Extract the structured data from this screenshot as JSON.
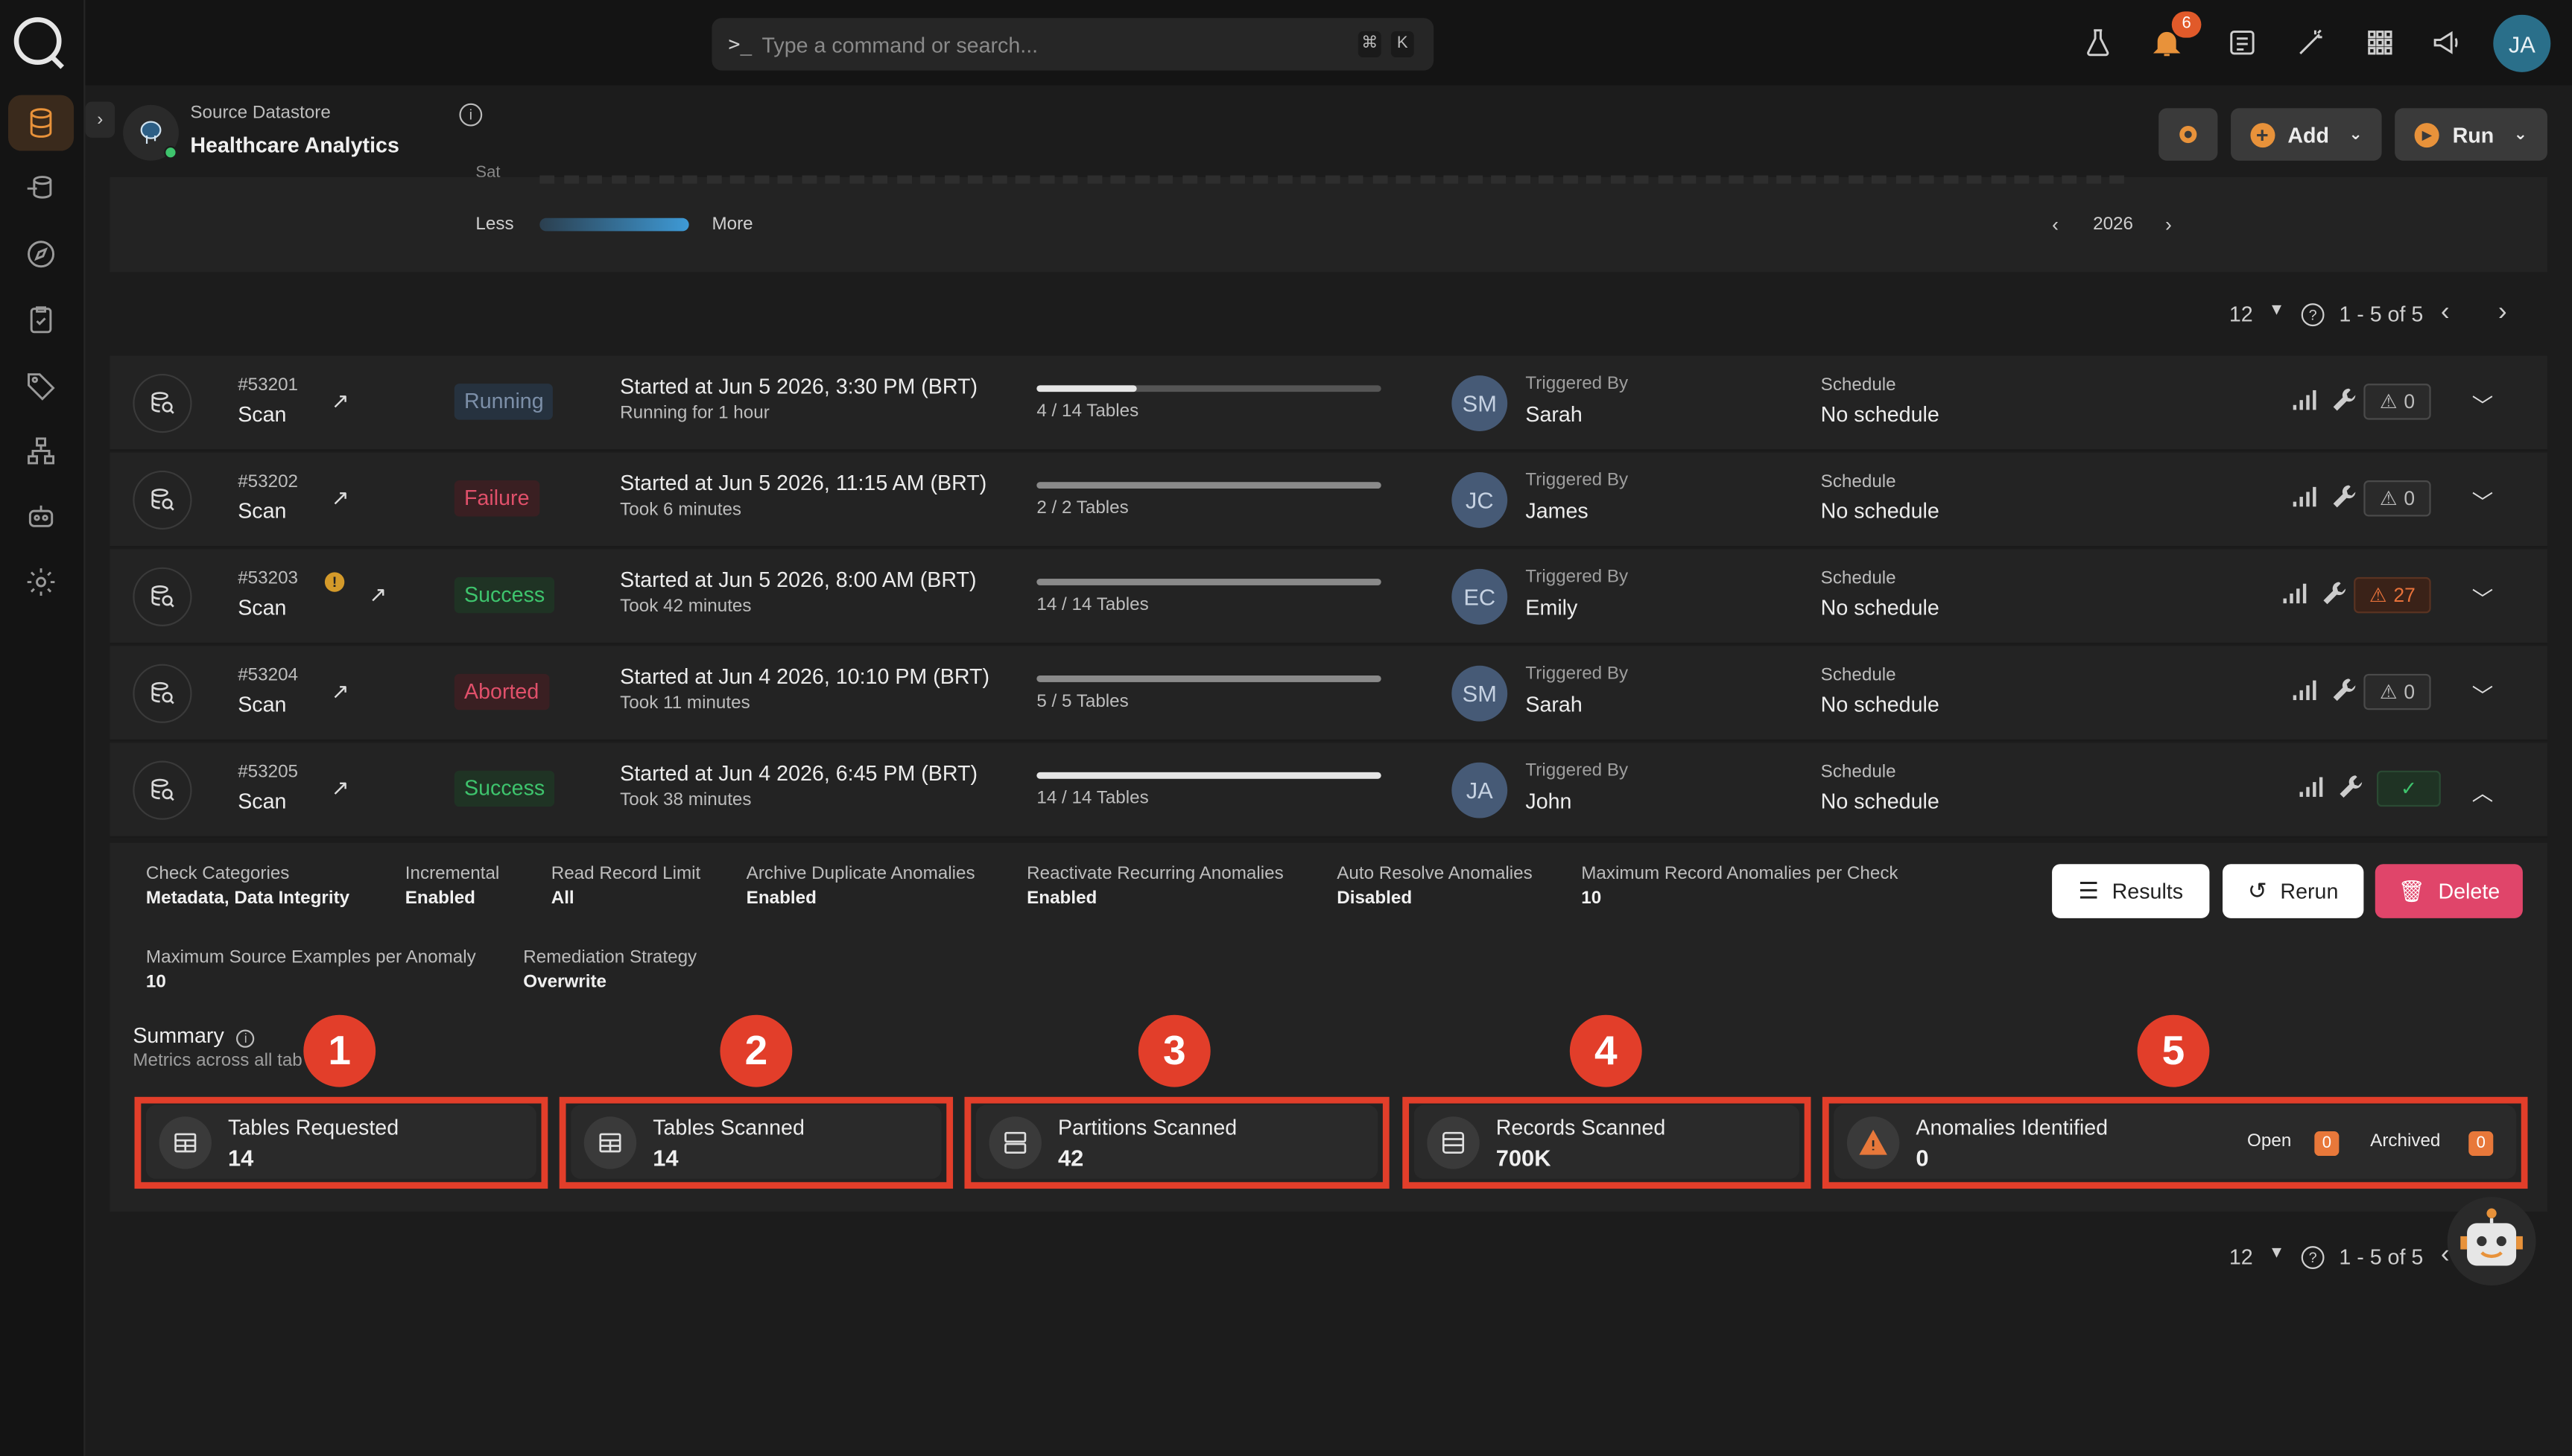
{
  "search": {
    "placeholder": "Type a command or search...",
    "shortcut_mod": "⌘",
    "shortcut_key": "K"
  },
  "notifications": {
    "count": "6"
  },
  "user": {
    "initials": "JA"
  },
  "datastore": {
    "label": "Source Datastore",
    "name": "Healthcare Analytics"
  },
  "header_buttons": {
    "add": "Add",
    "run": "Run"
  },
  "heatmap": {
    "less": "Less",
    "more": "More",
    "year": "2026",
    "clipped_label": "Sat"
  },
  "pager": {
    "per_page": "12",
    "range": "1 - 5 of 5"
  },
  "scans": [
    {
      "id": "#53201",
      "type": "Scan",
      "status": "Running",
      "started": "Started at Jun 5 2026, 3:30 PM (BRT)",
      "duration": "Running for 1 hour",
      "progress": 0.29,
      "tables": "4 / 14 Tables",
      "initials": "SM",
      "triggered_label": "Triggered By",
      "triggered_by": "Sarah",
      "schedule_label": "Schedule",
      "schedule": "No schedule",
      "anomalies": "0"
    },
    {
      "id": "#53202",
      "type": "Scan",
      "status": "Failure",
      "started": "Started at Jun 5 2026, 11:15 AM (BRT)",
      "duration": "Took 6 minutes",
      "progress": 1.0,
      "tables": "2 / 2 Tables",
      "initials": "JC",
      "triggered_label": "Triggered By",
      "triggered_by": "James",
      "schedule_label": "Schedule",
      "schedule": "No schedule",
      "anomalies": "0"
    },
    {
      "id": "#53203",
      "type": "Scan",
      "status": "Success",
      "started": "Started at Jun 5 2026, 8:00 AM (BRT)",
      "duration": "Took 42 minutes",
      "progress": 1.0,
      "tables": "14 / 14 Tables",
      "initials": "EC",
      "triggered_label": "Triggered By",
      "triggered_by": "Emily",
      "schedule_label": "Schedule",
      "schedule": "No schedule",
      "anomalies": "27"
    },
    {
      "id": "#53204",
      "type": "Scan",
      "status": "Aborted",
      "started": "Started at Jun 4 2026, 10:10 PM (BRT)",
      "duration": "Took 11 minutes",
      "progress": 1.0,
      "tables": "5 / 5 Tables",
      "initials": "SM",
      "triggered_label": "Triggered By",
      "triggered_by": "Sarah",
      "schedule_label": "Schedule",
      "schedule": "No schedule",
      "anomalies": "0"
    },
    {
      "id": "#53205",
      "type": "Scan",
      "status": "Success",
      "started": "Started at Jun 4 2026, 6:45 PM (BRT)",
      "duration": "Took 38 minutes",
      "progress": 1.0,
      "tables": "14 / 14 Tables",
      "initials": "JA",
      "triggered_label": "Triggered By",
      "triggered_by": "John",
      "schedule_label": "Schedule",
      "schedule": "No schedule",
      "anomalies": ""
    }
  ],
  "detail": {
    "meta": [
      {
        "label": "Check Categories",
        "value": "Metadata, Data Integrity"
      },
      {
        "label": "Incremental",
        "value": "Enabled"
      },
      {
        "label": "Read Record Limit",
        "value": "All"
      },
      {
        "label": "Archive Duplicate Anomalies",
        "value": "Enabled"
      },
      {
        "label": "Reactivate Recurring Anomalies",
        "value": "Enabled"
      },
      {
        "label": "Auto Resolve Anomalies",
        "value": "Disabled"
      },
      {
        "label": "Maximum Record Anomalies per Check",
        "value": "10"
      },
      {
        "label": "Maximum Source Examples per Anomaly",
        "value": "10"
      },
      {
        "label": "Remediation Strategy",
        "value": "Overwrite"
      }
    ],
    "buttons": {
      "results": "Results",
      "rerun": "Rerun",
      "delete": "Delete"
    },
    "summary_title": "Summary",
    "summary_sub": "Metrics across all tab",
    "cards": [
      {
        "label": "Tables Requested",
        "value": "14",
        "marker": "1"
      },
      {
        "label": "Tables Scanned",
        "value": "14",
        "marker": "2"
      },
      {
        "label": "Partitions Scanned",
        "value": "42",
        "marker": "3"
      },
      {
        "label": "Records Scanned",
        "value": "700K",
        "marker": "4"
      },
      {
        "label": "Anomalies Identified",
        "value": "0",
        "marker": "5",
        "open_label": "Open",
        "open": "0",
        "archived_label": "Archived",
        "archived": "0"
      }
    ]
  },
  "colors": {
    "accent": "#e8923a",
    "highlight": "#e23e2a",
    "success": "#3ec46d",
    "failure": "#e0506a",
    "delete": "#e0456a"
  }
}
